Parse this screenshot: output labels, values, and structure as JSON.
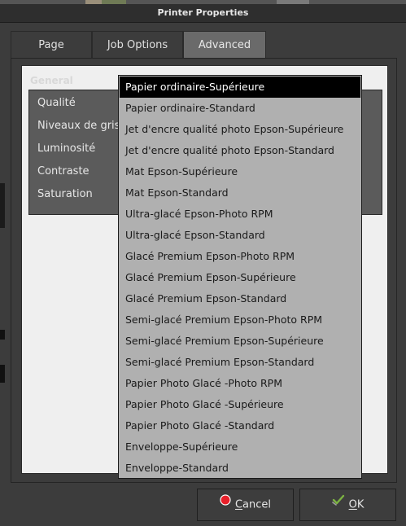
{
  "window": {
    "title": "Printer Properties"
  },
  "tabs": [
    {
      "label": "Page",
      "active": false
    },
    {
      "label": "Job Options",
      "active": false
    },
    {
      "label": "Advanced",
      "active": true
    }
  ],
  "advanced": {
    "group_title": "General",
    "settings": [
      {
        "label": "Qualité"
      },
      {
        "label": "Niveaux de gris"
      },
      {
        "label": "Luminosité"
      },
      {
        "label": "Contraste"
      },
      {
        "label": "Saturation"
      }
    ]
  },
  "quality_menu": {
    "selected_index": 0,
    "options": [
      "Papier ordinaire-Supérieure",
      "Papier ordinaire-Standard",
      "Jet d'encre qualité photo Epson-Supérieure",
      "Jet d'encre qualité photo Epson-Standard",
      "Mat Epson-Supérieure",
      "Mat Epson-Standard",
      "Ultra-glacé Epson-Photo RPM",
      "Ultra-glacé Epson-Standard",
      "Glacé Premium Epson-Photo RPM",
      "Glacé Premium Epson-Supérieure",
      "Glacé Premium Epson-Standard",
      "Semi-glacé Premium Epson-Photo RPM",
      "Semi-glacé Premium Epson-Supérieure",
      "Semi-glacé Premium Epson-Standard",
      "Papier Photo Glacé -Photo RPM",
      "Papier Photo Glacé -Supérieure",
      "Papier Photo Glacé -Standard",
      "Enveloppe-Supérieure",
      "Enveloppe-Standard"
    ]
  },
  "buttons": {
    "cancel_mnemonic": "C",
    "cancel_rest": "ancel",
    "cancel_icon": "red-circle-icon",
    "ok_mnemonic": "O",
    "ok_rest": "K",
    "ok_icon": "check-arrow-icon"
  },
  "colors": {
    "dialog_bg": "#3c3c3c",
    "active_tab": "#6a6a6a",
    "menu_bg": "#b0b0b0",
    "menu_selected": "#000000",
    "cancel_icon": "#e8202a",
    "ok_icon": "#7cb342"
  }
}
